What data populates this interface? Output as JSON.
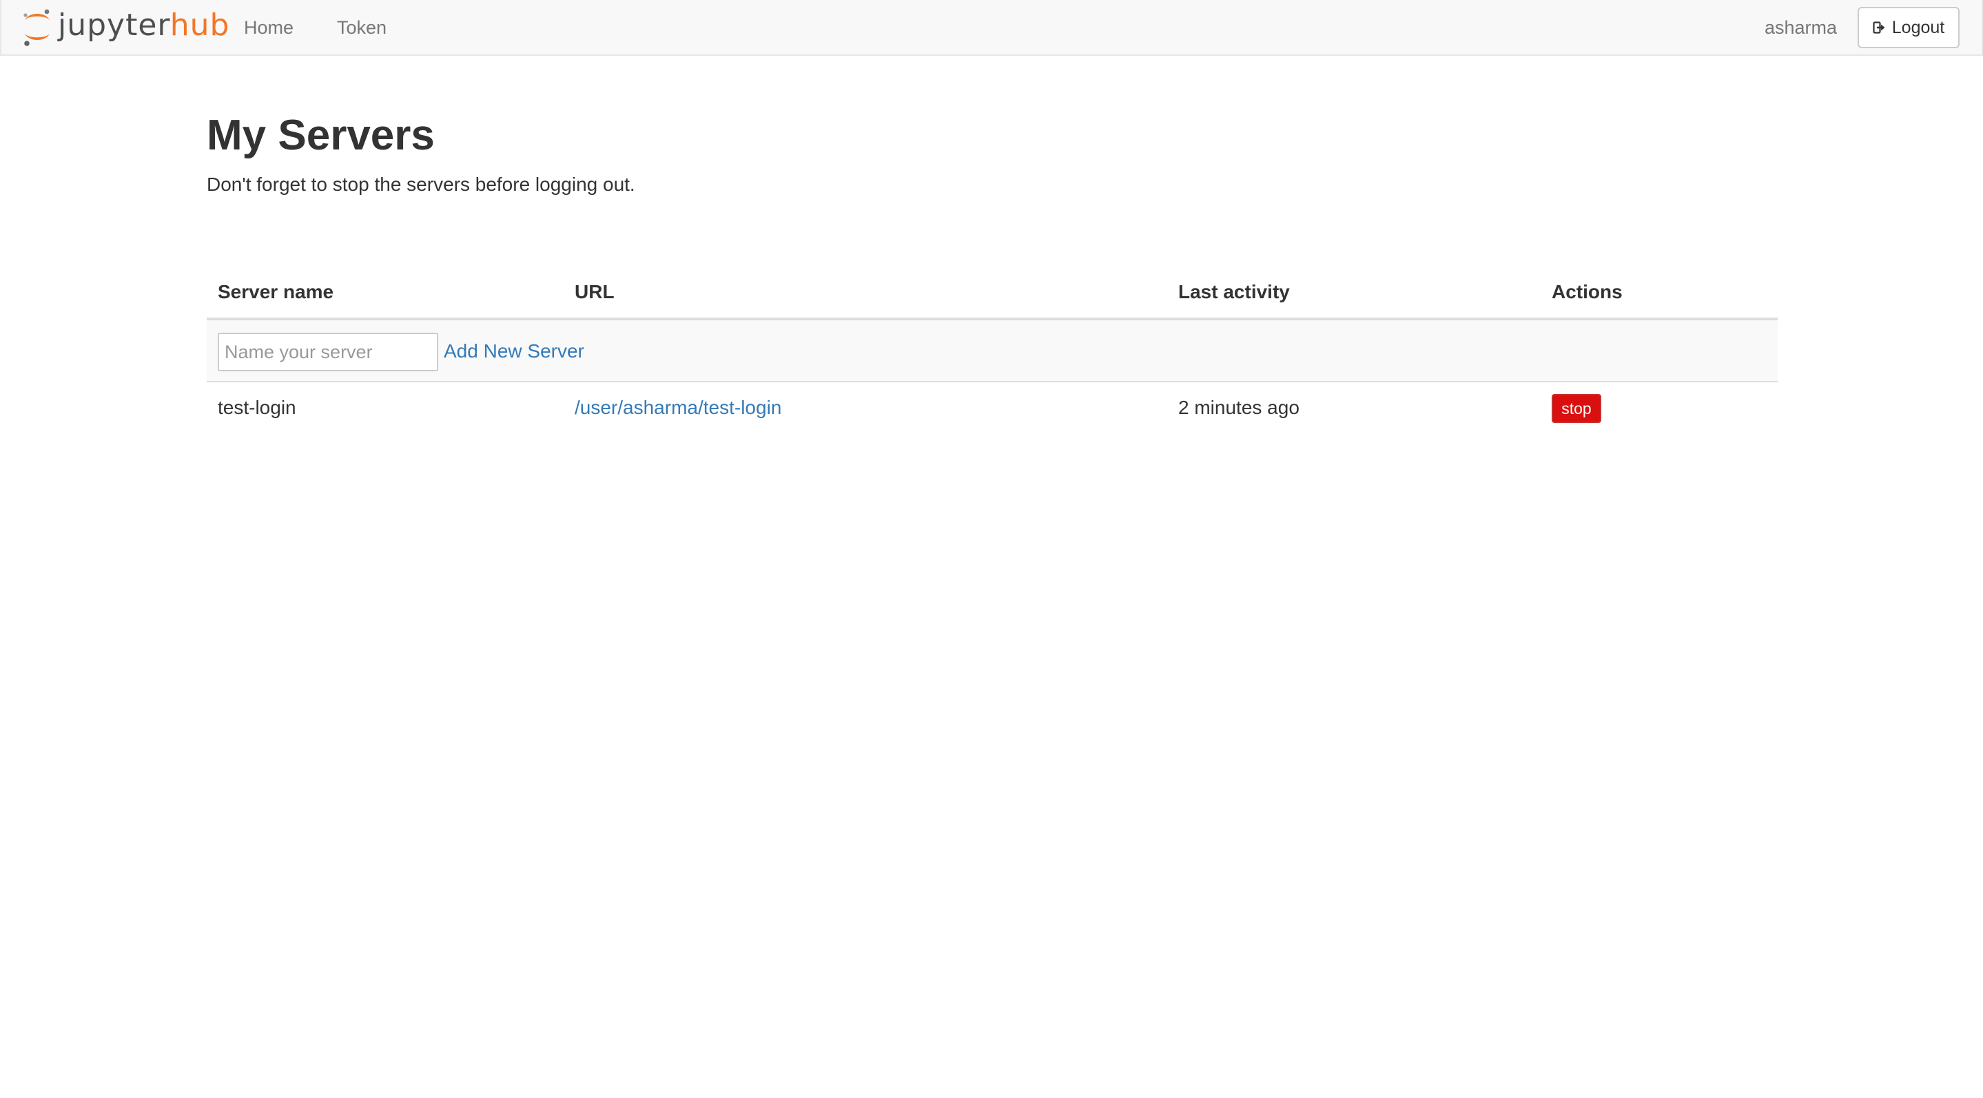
{
  "brand": {
    "part1": "jupyter",
    "part2": "hub",
    "colors": {
      "part1": "#4e4e4e",
      "part2": "#f37726"
    }
  },
  "nav": {
    "home_label": "Home",
    "token_label": "Token",
    "username": "asharma",
    "logout_label": "Logout",
    "logout_icon": "sign-out-icon"
  },
  "main": {
    "title": "My Servers",
    "note": "Don't forget to stop the servers before logging out."
  },
  "table": {
    "headers": {
      "name": "Server name",
      "url": "URL",
      "activity": "Last activity",
      "actions": "Actions"
    },
    "new_server": {
      "placeholder": "Name your server",
      "value": "",
      "add_label": "Add New Server"
    },
    "rows": [
      {
        "name": "test-login",
        "url": "/user/asharma/test-login",
        "last_activity": "2 minutes ago",
        "action_label": "stop"
      }
    ]
  },
  "colors": {
    "link": "#337ab7",
    "danger": "#d9100f",
    "navbar_bg": "#f8f8f8"
  }
}
